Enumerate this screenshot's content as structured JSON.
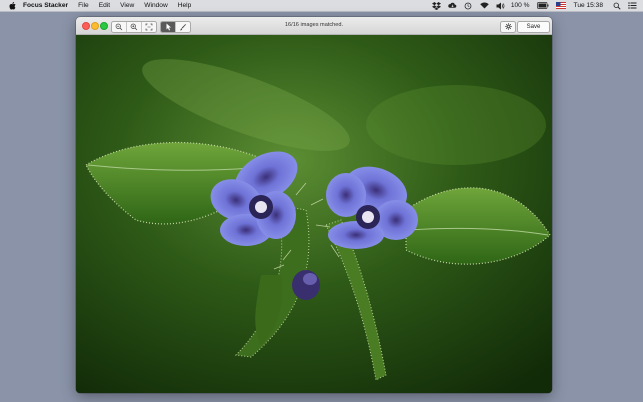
{
  "menubar": {
    "app_name": "Focus Stacker",
    "items": [
      "File",
      "Edit",
      "View",
      "Window",
      "Help"
    ],
    "battery": "100 %",
    "clock": "Tue 15:38",
    "status_icons": [
      "dropbox-icon",
      "cloud-icon",
      "time-machine-icon",
      "wifi-icon",
      "volume-icon",
      "battery-icon",
      "flag-icon",
      "spotlight-icon",
      "notification-icon"
    ]
  },
  "window": {
    "status": "16/16 images matched.",
    "save_label": "Save",
    "zoom_tools": [
      "zoom-out-icon",
      "zoom-in-icon",
      "zoom-fit-icon"
    ],
    "edit_tools": [
      "pointer-icon",
      "brush-icon"
    ],
    "photo_subject": "flower-photo"
  },
  "colors": {
    "desktop": "#8a93a8",
    "petal": "#6b6fd0",
    "leaf": "#3f7a1f"
  }
}
